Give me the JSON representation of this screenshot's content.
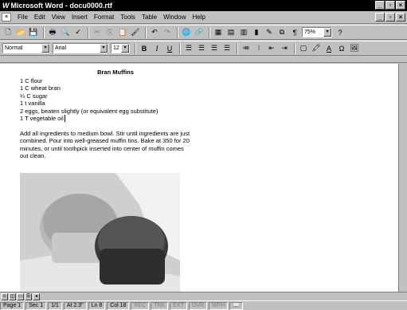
{
  "window": {
    "title": "Microsoft Word - docu0000.rtf",
    "logo": "W"
  },
  "menu": [
    "File",
    "Edit",
    "View",
    "Insert",
    "Format",
    "Tools",
    "Table",
    "Window",
    "Help"
  ],
  "formatting": {
    "style": "Normal",
    "font": "Arial",
    "size": "12",
    "zoom": "75%"
  },
  "document": {
    "title": "Bran Muffins",
    "ingredients": [
      "1 C flour",
      "1 C wheat bran",
      "¼ C sugar",
      "1 t vanilla",
      "2 eggs, beaten slightly (or equivalent egg substitute)",
      "1 T vegetable oil"
    ],
    "instructions": "Add all ingredients to medium bowl. Stir until ingredients are just combined. Pour into well-greased muffin tins. Bake at 350 for 20 minutes, or until toothpick inserted into center of muffin comes out clean."
  },
  "status": {
    "page": "Page 1",
    "sec": "Sec 1",
    "pages": "1/1",
    "at": "At 2.3\"",
    "ln": "Ln 8",
    "col": "Col 18",
    "rec": "REC",
    "trk": "TRK",
    "ext": "EXT",
    "ovr": "OVR",
    "wph": "WPH"
  }
}
